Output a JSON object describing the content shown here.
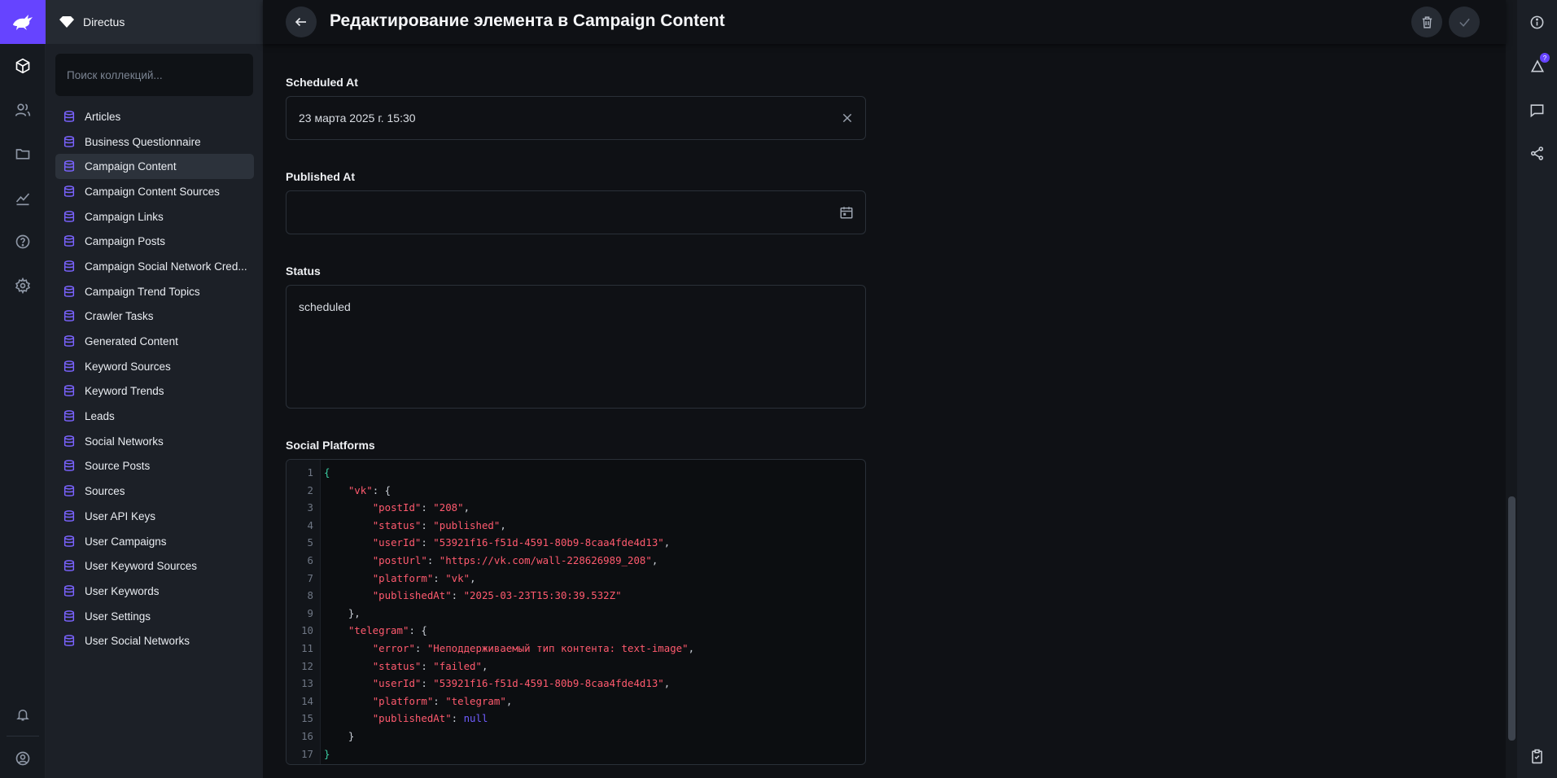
{
  "project": {
    "name": "Directus"
  },
  "search": {
    "placeholder": "Поиск коллекций..."
  },
  "collections": [
    {
      "label": "Articles"
    },
    {
      "label": "Business Questionnaire"
    },
    {
      "label": "Campaign Content",
      "active": true
    },
    {
      "label": "Campaign Content Sources"
    },
    {
      "label": "Campaign Links"
    },
    {
      "label": "Campaign Posts"
    },
    {
      "label": "Campaign Social Network Cred..."
    },
    {
      "label": "Campaign Trend Topics"
    },
    {
      "label": "Crawler Tasks"
    },
    {
      "label": "Generated Content"
    },
    {
      "label": "Keyword Sources"
    },
    {
      "label": "Keyword Trends"
    },
    {
      "label": "Leads"
    },
    {
      "label": "Social Networks"
    },
    {
      "label": "Source Posts"
    },
    {
      "label": "Sources"
    },
    {
      "label": "User API Keys"
    },
    {
      "label": "User Campaigns"
    },
    {
      "label": "User Keyword Sources"
    },
    {
      "label": "User Keywords"
    },
    {
      "label": "User Settings"
    },
    {
      "label": "User Social Networks"
    }
  ],
  "header": {
    "title": "Редактирование элемента в Campaign Content"
  },
  "fields": {
    "scheduled_at": {
      "label": "Scheduled At",
      "value": "23 марта 2025 г. 15:30"
    },
    "published_at": {
      "label": "Published At",
      "value": ""
    },
    "status": {
      "label": "Status",
      "value": "scheduled"
    },
    "social_platforms": {
      "label": "Social Platforms"
    }
  },
  "code_lines": [
    [
      [
        "b",
        "{"
      ]
    ],
    [
      [
        "p",
        "    "
      ],
      [
        "k",
        "\"vk\""
      ],
      [
        "p",
        ": {"
      ]
    ],
    [
      [
        "p",
        "        "
      ],
      [
        "k",
        "\"postId\""
      ],
      [
        "p",
        ": "
      ],
      [
        "s",
        "\"208\""
      ],
      [
        "p",
        ","
      ]
    ],
    [
      [
        "p",
        "        "
      ],
      [
        "k",
        "\"status\""
      ],
      [
        "p",
        ": "
      ],
      [
        "s",
        "\"published\""
      ],
      [
        "p",
        ","
      ]
    ],
    [
      [
        "p",
        "        "
      ],
      [
        "k",
        "\"userId\""
      ],
      [
        "p",
        ": "
      ],
      [
        "s",
        "\"53921f16-f51d-4591-80b9-8caa4fde4d13\""
      ],
      [
        "p",
        ","
      ]
    ],
    [
      [
        "p",
        "        "
      ],
      [
        "k",
        "\"postUrl\""
      ],
      [
        "p",
        ": "
      ],
      [
        "s",
        "\"https://vk.com/wall-228626989_208\""
      ],
      [
        "p",
        ","
      ]
    ],
    [
      [
        "p",
        "        "
      ],
      [
        "k",
        "\"platform\""
      ],
      [
        "p",
        ": "
      ],
      [
        "s",
        "\"vk\""
      ],
      [
        "p",
        ","
      ]
    ],
    [
      [
        "p",
        "        "
      ],
      [
        "k",
        "\"publishedAt\""
      ],
      [
        "p",
        ": "
      ],
      [
        "s",
        "\"2025-03-23T15:30:39.532Z\""
      ]
    ],
    [
      [
        "p",
        "    },"
      ]
    ],
    [
      [
        "p",
        "    "
      ],
      [
        "k",
        "\"telegram\""
      ],
      [
        "p",
        ": {"
      ]
    ],
    [
      [
        "p",
        "        "
      ],
      [
        "k",
        "\"error\""
      ],
      [
        "p",
        ": "
      ],
      [
        "s",
        "\"Неподдерживаемый тип контента: text-image\""
      ],
      [
        "p",
        ","
      ]
    ],
    [
      [
        "p",
        "        "
      ],
      [
        "k",
        "\"status\""
      ],
      [
        "p",
        ": "
      ],
      [
        "s",
        "\"failed\""
      ],
      [
        "p",
        ","
      ]
    ],
    [
      [
        "p",
        "        "
      ],
      [
        "k",
        "\"userId\""
      ],
      [
        "p",
        ": "
      ],
      [
        "s",
        "\"53921f16-f51d-4591-80b9-8caa4fde4d13\""
      ],
      [
        "p",
        ","
      ]
    ],
    [
      [
        "p",
        "        "
      ],
      [
        "k",
        "\"platform\""
      ],
      [
        "p",
        ": "
      ],
      [
        "s",
        "\"telegram\""
      ],
      [
        "p",
        ","
      ]
    ],
    [
      [
        "p",
        "        "
      ],
      [
        "k",
        "\"publishedAt\""
      ],
      [
        "p",
        ": "
      ],
      [
        "n",
        "null"
      ]
    ],
    [
      [
        "p",
        "    }"
      ]
    ],
    [
      [
        "b",
        "}"
      ]
    ]
  ],
  "icons": {
    "modules": [
      "content-module-icon",
      "users-module-icon",
      "files-module-icon",
      "insights-module-icon",
      "help-icon",
      "settings-icon",
      "notifications-icon",
      "user-profile-icon"
    ],
    "sidebar": [
      "info-icon",
      "revisions-icon",
      "comments-icon",
      "share-icon",
      "clipboard-icon"
    ]
  },
  "revisions_badge": "?",
  "colors": {
    "accent": "#6644ff",
    "string": "#ff5a6e",
    "brace": "#3ccfa4",
    "null": "#6f5cff"
  }
}
